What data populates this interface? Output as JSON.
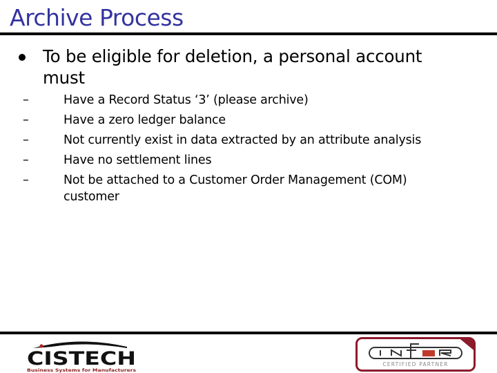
{
  "slide": {
    "title": "Archive Process",
    "main_bullet": "To be eligible for deletion, a personal account must",
    "sub_dash": "–",
    "sub_items": [
      "Have a Record Status ‘3’ (please archive)",
      "Have a zero ledger balance",
      "Not currently exist in data extracted by an attribute analysis",
      "Have no settlement lines",
      "Not be attached to a Customer Order Management (COM) customer"
    ]
  },
  "footer": {
    "left_logo": {
      "name": "CISTECH",
      "tagline": "Business Systems for Manufacturers",
      "accent_color": "#b22222"
    },
    "right_logo": {
      "name_parts": [
        "I",
        "N",
        "F",
        "O",
        "R"
      ],
      "subtitle": "CERTIFIED PARTNER",
      "frame_color": "#8b1a2b",
      "accent_color": "#c0392b"
    }
  },
  "colors": {
    "title": "#3333a0",
    "rules": "#000000",
    "text": "#000000"
  }
}
